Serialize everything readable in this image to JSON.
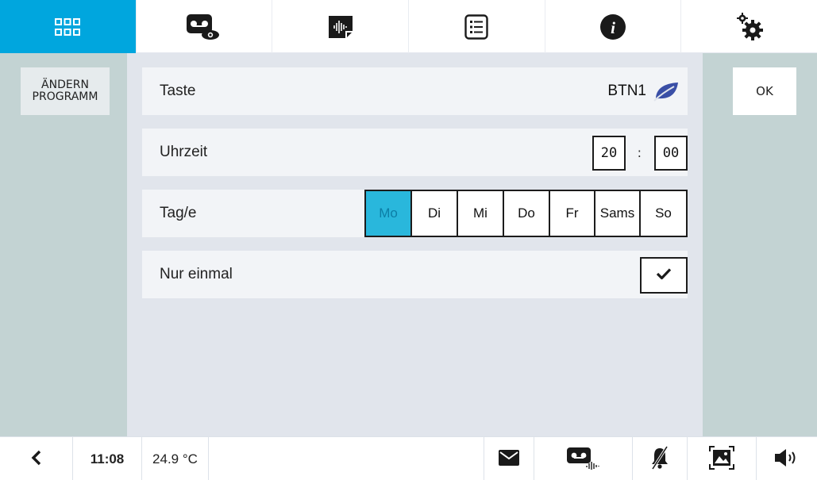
{
  "top_nav": [
    {
      "name": "home-grid",
      "icon": "grid-icon",
      "active": true
    },
    {
      "name": "video-memo",
      "icon": "voicemail-eye-icon",
      "active": false
    },
    {
      "name": "audio-memo",
      "icon": "audio-note-icon",
      "active": false
    },
    {
      "name": "list",
      "icon": "list-icon",
      "active": false
    },
    {
      "name": "info",
      "icon": "info-icon",
      "active": false
    },
    {
      "name": "settings",
      "icon": "gears-icon",
      "active": false
    }
  ],
  "left_panel": {
    "change_program_label_line1": "ÄNDERN",
    "change_program_label_line2": "PROGRAMM"
  },
  "right_panel": {
    "ok_label": "OK"
  },
  "form": {
    "taste": {
      "label": "Taste",
      "value": "BTN1",
      "icon": "leaf-icon"
    },
    "time": {
      "label": "Uhrzeit",
      "hour": "20",
      "separator": ":",
      "minute": "00"
    },
    "days": {
      "label": "Tag/e",
      "options": [
        "Mo",
        "Di",
        "Mi",
        "Do",
        "Fr",
        "Sams",
        "So"
      ],
      "selected": "Mo"
    },
    "once": {
      "label": "Nur einmal",
      "checked": true
    }
  },
  "status_bar": {
    "time": "11:08",
    "temperature": "24.9 °C"
  },
  "colors": {
    "accent": "#00a6de",
    "selected_day": "#29b7dc",
    "side_panel": "#c3d3d3",
    "center_bg": "#e1e5ec",
    "leaf": "#3a4fa6"
  }
}
